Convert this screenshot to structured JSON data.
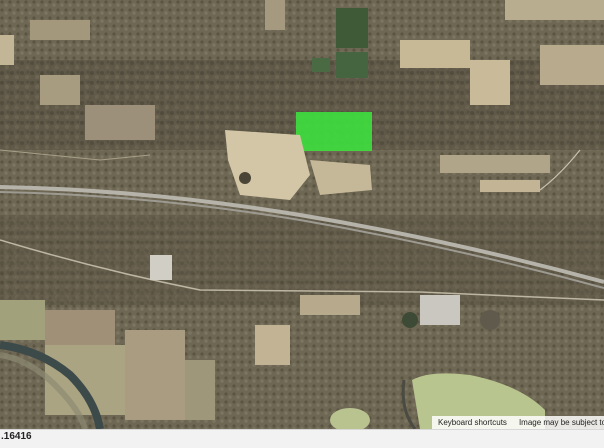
{
  "map": {
    "type": "satellite",
    "highlight_color": "#3ee03e"
  },
  "attribution": {
    "keyboard_shortcuts": "Keyboard shortcuts",
    "copyright_notice": "Image may be subject to copyright"
  },
  "coordinate_readout": ".16416"
}
